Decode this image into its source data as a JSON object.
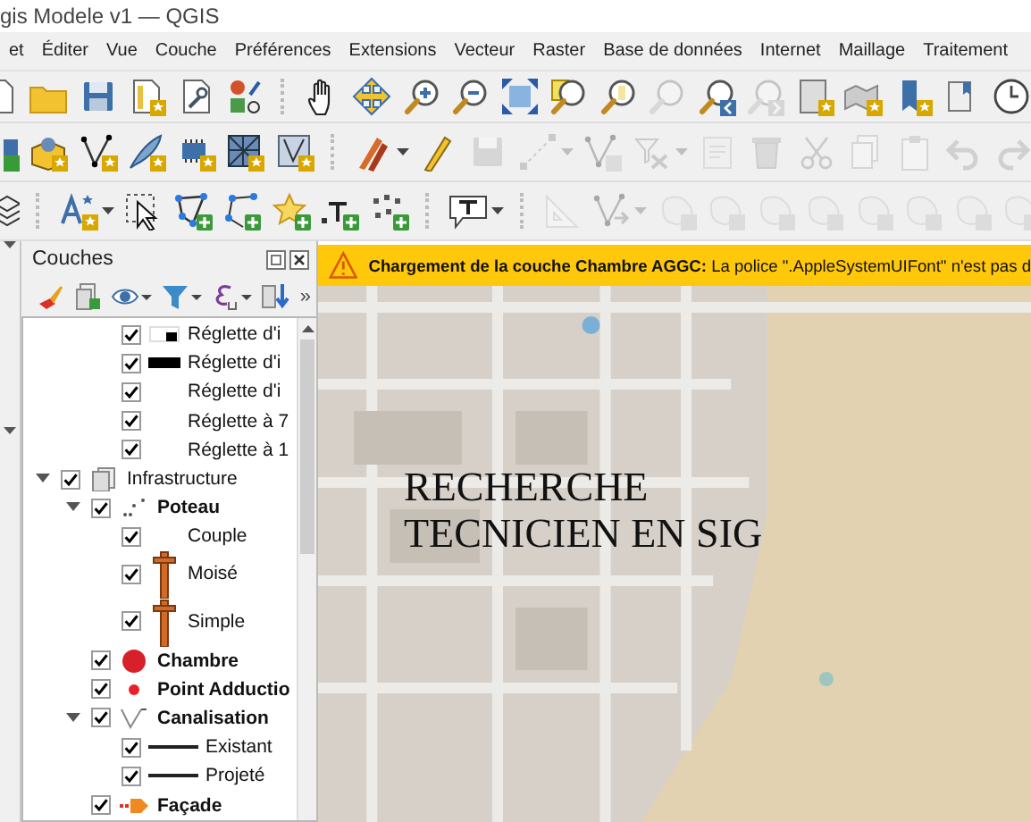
{
  "window": {
    "title": "gis Modele v1 — QGIS"
  },
  "menu": [
    {
      "label": "et"
    },
    {
      "label": "Éditer"
    },
    {
      "label": "Vue"
    },
    {
      "label": "Couche"
    },
    {
      "label": "Préférences"
    },
    {
      "label": "Extensions"
    },
    {
      "label": "Vecteur"
    },
    {
      "label": "Raster"
    },
    {
      "label": "Base de données"
    },
    {
      "label": "Internet"
    },
    {
      "label": "Maillage"
    },
    {
      "label": "Traitement"
    }
  ],
  "toolbars": [
    {
      "buttons": [
        {
          "disabled": false
        },
        {
          "disabled": false
        },
        {
          "disabled": false
        },
        {
          "disabled": false
        },
        {
          "disabled": false
        },
        {
          "disabled": false
        },
        {
          "disabled": false
        },
        {
          "disabled": false
        },
        {
          "disabled": false
        },
        {
          "disabled": false
        },
        {
          "disabled": false
        },
        {
          "disabled": false
        },
        {
          "disabled": false
        },
        {
          "disabled": true
        },
        {
          "disabled": false
        },
        {
          "disabled": true
        },
        {
          "disabled": false
        },
        {
          "disabled": false
        },
        {
          "disabled": false
        },
        {
          "disabled": false
        },
        {
          "disabled": false
        }
      ]
    },
    {
      "buttons": [
        {
          "disabled": false
        },
        {
          "disabled": false
        },
        {
          "disabled": false
        },
        {
          "disabled": false
        },
        {
          "disabled": false
        },
        {
          "disabled": false
        },
        {
          "disabled": false
        },
        {
          "disabled": false
        },
        {
          "disabled": false
        },
        {
          "disabled": true
        },
        {
          "disabled": true
        },
        {
          "disabled": true
        },
        {
          "disabled": true
        },
        {
          "disabled": true
        },
        {
          "disabled": true
        },
        {
          "disabled": true
        },
        {
          "disabled": true
        },
        {
          "disabled": true
        },
        {
          "disabled": true
        },
        {
          "disabled": true
        }
      ]
    },
    {
      "buttons": [
        {
          "disabled": false
        },
        {
          "disabled": false
        },
        {
          "disabled": false
        },
        {
          "disabled": false
        },
        {
          "disabled": false
        },
        {
          "disabled": false
        },
        {
          "disabled": false
        },
        {
          "disabled": false
        },
        {
          "disabled": false
        },
        {
          "disabled": true
        },
        {
          "disabled": true
        },
        {
          "disabled": true
        },
        {
          "disabled": true
        },
        {
          "disabled": true
        },
        {
          "disabled": true
        },
        {
          "disabled": true
        },
        {
          "disabled": true
        },
        {
          "disabled": true
        },
        {
          "disabled": true
        }
      ]
    }
  ],
  "layers_panel": {
    "title": "Couches",
    "more": "»",
    "tree": [
      {
        "children": [
          {
            "children": [
              {
                "label": "Réglette d'i",
                "kind": "class",
                "checked": true
              },
              {
                "label": "Réglette d'i",
                "kind": "class",
                "checked": true
              },
              {
                "label": "Réglette d'i",
                "kind": "class",
                "checked": true
              },
              {
                "label": "Réglette à 7",
                "kind": "class",
                "checked": true
              },
              {
                "label": "Réglette à 1",
                "kind": "class",
                "checked": true
              }
            ]
          }
        ]
      },
      {
        "label": "Infrastructure",
        "kind": "group",
        "checked": true,
        "expanded": true,
        "children": [
          {
            "label": "Poteau",
            "kind": "layer",
            "checked": true,
            "expanded": true,
            "children": [
              {
                "label": "Couple",
                "kind": "class",
                "checked": true
              },
              {
                "label": "Moisé",
                "kind": "class",
                "checked": true
              },
              {
                "label": "Simple",
                "kind": "class",
                "checked": true
              }
            ]
          },
          {
            "label": "Chambre",
            "kind": "layer",
            "checked": true
          },
          {
            "label": "Point Adductio",
            "kind": "layer",
            "checked": true
          },
          {
            "label": "Canalisation",
            "kind": "layer",
            "checked": true,
            "expanded": true,
            "children": [
              {
                "label": "Existant",
                "kind": "class",
                "checked": true
              },
              {
                "label": "Projeté",
                "kind": "class",
                "checked": true
              }
            ]
          },
          {
            "label": "Façade",
            "kind": "layer",
            "checked": true
          }
        ]
      }
    ]
  },
  "map": {
    "message": "**Chargement de la couche Chambre AGGC:** La police \".AppleSystemUIFont\" n'est pas d",
    "label_lines": [
      "RECHERCHE",
      "TECNICIEN EN SIG"
    ]
  }
}
